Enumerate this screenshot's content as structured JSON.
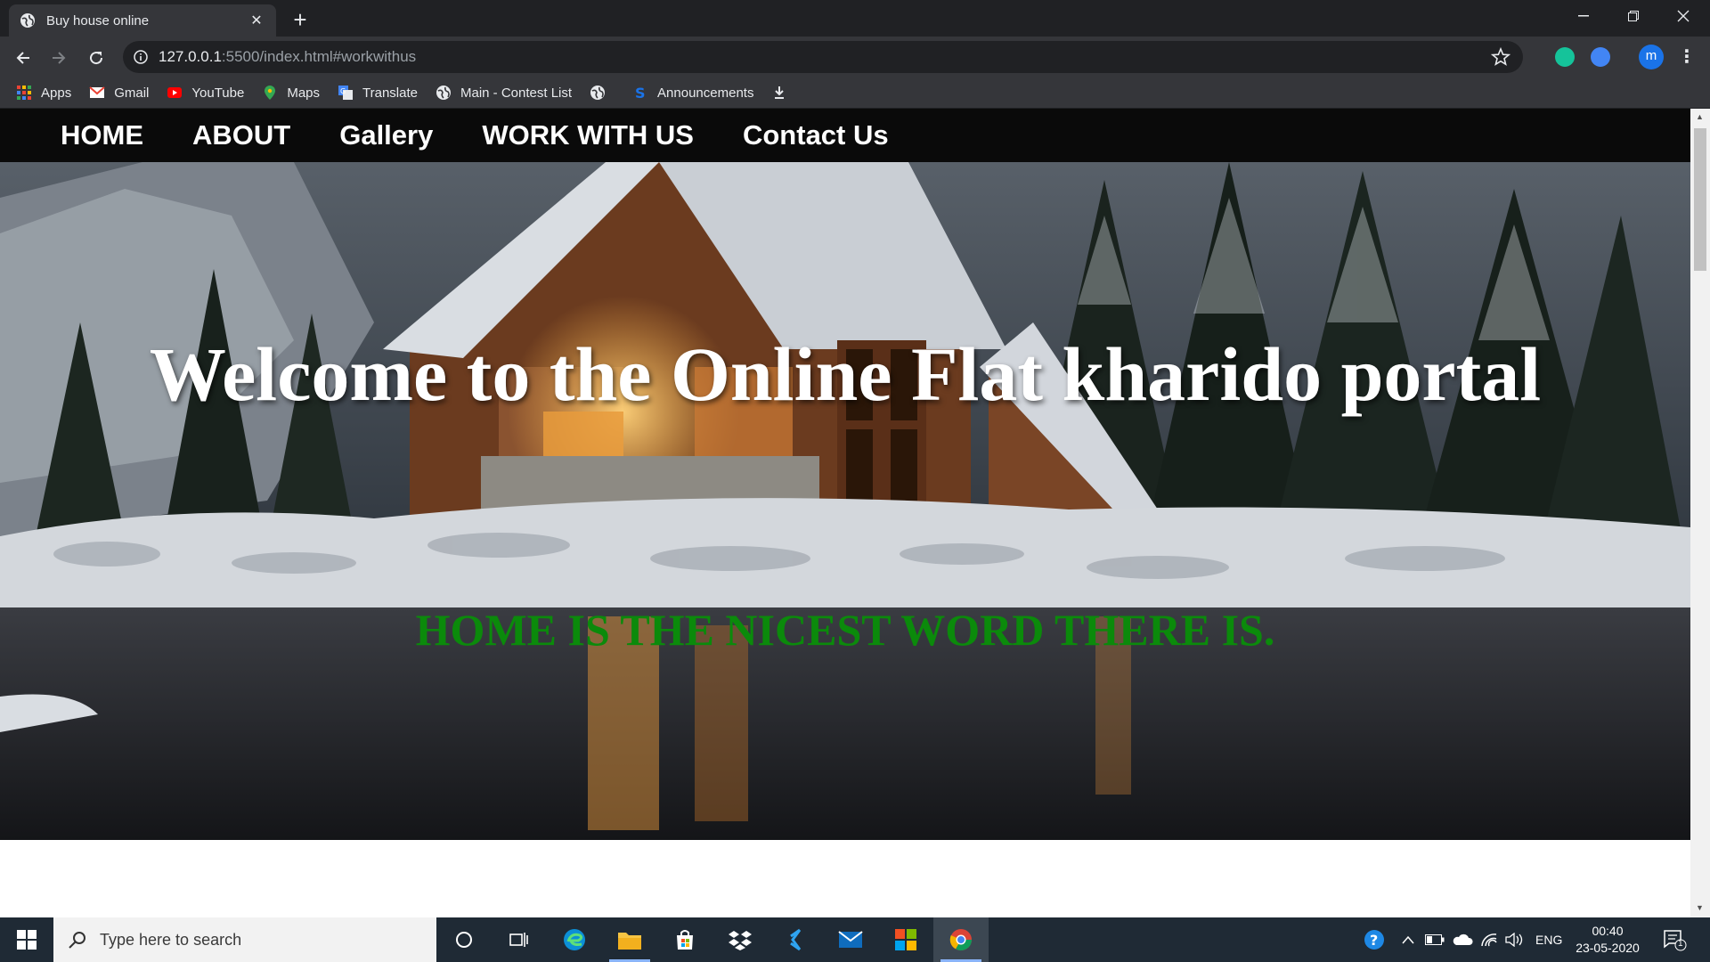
{
  "browser": {
    "tab_title": "Buy house online",
    "url_host": "127.0.0.1",
    "url_rest": ":5500/index.html#workwithus",
    "profile_initial": "m"
  },
  "bookmarks": [
    {
      "label": "Apps",
      "icon": "apps-grid-icon"
    },
    {
      "label": "Gmail",
      "icon": "gmail-icon"
    },
    {
      "label": "YouTube",
      "icon": "youtube-icon"
    },
    {
      "label": "Maps",
      "icon": "maps-icon"
    },
    {
      "label": "Translate",
      "icon": "translate-icon"
    },
    {
      "label": "Main - Contest List",
      "icon": "globe-icon"
    },
    {
      "label": "",
      "icon": "globe-icon"
    },
    {
      "label": "Announcements",
      "icon": "s-icon"
    },
    {
      "label": "",
      "icon": "download-icon"
    }
  ],
  "site": {
    "nav": [
      "HOME",
      "ABOUT",
      "Gallery",
      "WORK WITH US",
      "Contact Us"
    ],
    "hero_title": "Welcome to the Online Flat kharido portal",
    "hero_tagline": "HOME IS THE NICEST WORD THERE IS."
  },
  "taskbar": {
    "search_placeholder": "Type here to search",
    "lang": "ENG",
    "time": "00:40",
    "date": "23-05-2020",
    "notification_count": "1"
  },
  "colors": {
    "tagline": "#0b8a0b",
    "nav_bg": "#0a0a0a",
    "chrome_dark": "#202124",
    "chrome_mid": "#35363a"
  }
}
